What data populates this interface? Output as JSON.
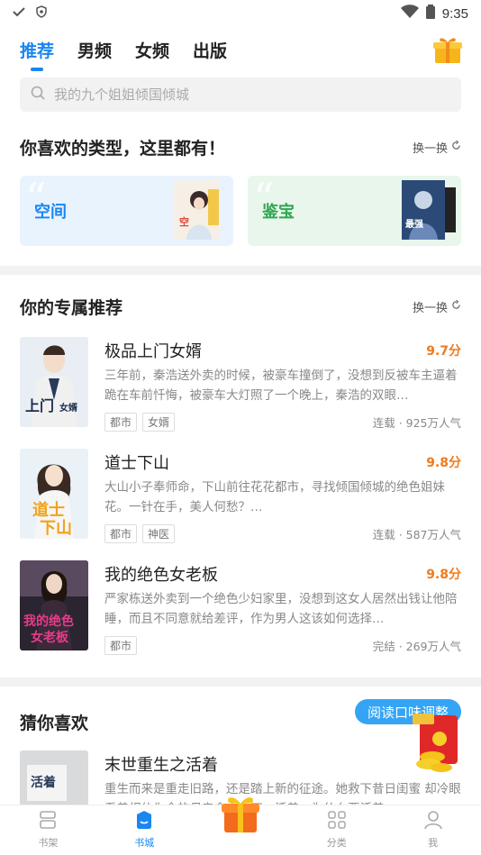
{
  "status_bar": {
    "time": "9:35"
  },
  "tabs": [
    {
      "label": "推荐",
      "active": true
    },
    {
      "label": "男频",
      "active": false
    },
    {
      "label": "女频",
      "active": false
    },
    {
      "label": "出版",
      "active": false
    }
  ],
  "search": {
    "placeholder": "我的九个姐姐倾国倾城"
  },
  "genre_section": {
    "title": "你喜欢的类型，这里都有！",
    "refresh_label": "换一换",
    "cards": [
      {
        "label": "空间",
        "color": "#1a86f0"
      },
      {
        "label": "鉴宝",
        "color": "#2fa74f"
      }
    ]
  },
  "recommend_section": {
    "title": "你的专属推荐",
    "refresh_label": "换一换",
    "books": [
      {
        "title": "极品上门女婿",
        "score": "9.7分",
        "desc": "三年前，秦浩送外卖的时候，被豪车撞倒了，没想到反被车主逼着跪在车前忏悔，被豪车大灯照了一个晚上，秦浩的双眼…",
        "tags": [
          "都市",
          "女婿"
        ],
        "stat": "连载 · 925万人气"
      },
      {
        "title": "道士下山",
        "score": "9.8分",
        "desc": "大山小子奉师命，下山前往花花都市，寻找倾国倾城的绝色姐妹花。一针在手，美人何愁？…",
        "tags": [
          "都市",
          "神医"
        ],
        "stat": "连载 · 587万人气"
      },
      {
        "title": "我的绝色女老板",
        "score": "9.8分",
        "desc": "严家栋送外卖到一个绝色少妇家里，没想到这女人居然出钱让他陪睡，而且不同意就给差评，作为男人这该如何选择…",
        "tags": [
          "都市"
        ],
        "stat": "完结 · 269万人气"
      }
    ]
  },
  "guess_section": {
    "title": "猜你喜欢",
    "adjust_label": "阅读口味调整",
    "books": [
      {
        "title": "末世重生之活着",
        "desc": "重生而来是重走旧路，还是踏上新的征途。她救下昔日闺蜜 却冷眼看着相依为命的母亲命丧车下。活着，为什么要活着，…"
      }
    ]
  },
  "bottom_nav": [
    {
      "label": "书架",
      "active": false
    },
    {
      "label": "书城",
      "active": true
    },
    {
      "label": "",
      "active": false
    },
    {
      "label": "分类",
      "active": false
    },
    {
      "label": "我",
      "active": false
    }
  ],
  "colors": {
    "accent": "#1a86f0",
    "score": "#f07a1a",
    "green": "#2fa74f"
  }
}
